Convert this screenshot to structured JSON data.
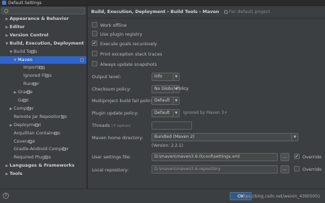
{
  "window": {
    "title": "Default Settings"
  },
  "sidebar": {
    "items": [
      {
        "label": "Appearance & Behavior",
        "arrow": "▶",
        "level": 0,
        "bold": true
      },
      {
        "label": "Editor",
        "arrow": "▶",
        "level": 0,
        "bold": true
      },
      {
        "label": "Version Control",
        "arrow": "▶",
        "level": 0,
        "bold": true
      },
      {
        "label": "Build, Execution, Deployment",
        "arrow": "▼",
        "level": 0,
        "bold": true
      },
      {
        "label": "Build Tools",
        "arrow": "▼",
        "level": 1
      },
      {
        "label": "Maven",
        "arrow": "▼",
        "level": 2,
        "active": true
      },
      {
        "label": "Importing",
        "arrow": "",
        "level": 3
      },
      {
        "label": "Ignored Files",
        "arrow": "",
        "level": 3
      },
      {
        "label": "Runner",
        "arrow": "",
        "level": 3
      },
      {
        "label": "Gradle",
        "arrow": "▶",
        "level": 2
      },
      {
        "label": "Gant",
        "arrow": "",
        "level": 2
      },
      {
        "label": "Compiler",
        "arrow": "▶",
        "level": 1
      },
      {
        "label": "Remote Jar Repositories",
        "arrow": "",
        "level": 1
      },
      {
        "label": "Deployment",
        "arrow": "▶",
        "level": 1
      },
      {
        "label": "Arquillian Containers",
        "arrow": "",
        "level": 1
      },
      {
        "label": "Coverage",
        "arrow": "",
        "level": 1
      },
      {
        "label": "Gradle-Android Compiler",
        "arrow": "",
        "level": 1
      },
      {
        "label": "Required Plugins",
        "arrow": "",
        "level": 1
      },
      {
        "label": "Languages & Frameworks",
        "arrow": "▶",
        "level": 0,
        "bold": true
      },
      {
        "label": "Tools",
        "arrow": "▶",
        "level": 0,
        "bold": true
      }
    ]
  },
  "breadcrumb": {
    "path": "Build, Execution, Deployment › Build Tools › Maven",
    "scope": "For default project"
  },
  "checkboxes": [
    {
      "label": "Work offline",
      "checked": false
    },
    {
      "label": "Use plugin registry",
      "checked": false
    },
    {
      "label": "Execute goals recursively",
      "checked": true
    },
    {
      "label": "Print exception stack traces",
      "checked": false
    },
    {
      "label": "Always update snapshots",
      "checked": false
    }
  ],
  "fields": {
    "output_level": {
      "label": "Output level:",
      "value": "Info"
    },
    "checksum_policy": {
      "label": "Checksum policy:",
      "value": "No Global Policy"
    },
    "build_fail_policy": {
      "label": "Multiproject build fail policy:",
      "value": "Default"
    },
    "plugin_update_policy": {
      "label": "Plugin update policy:",
      "value": "Default",
      "note": "ignored by Maven 3+"
    },
    "threads": {
      "label": "Threads",
      "hint": "(-T option)",
      "value": ""
    },
    "maven_home": {
      "label": "Maven home directory:",
      "value": "Bundled (Maven 2)",
      "version": "(Version: 2.2.1)"
    },
    "user_settings": {
      "label": "User settings file:",
      "value": "D:\\maven\\maven3.6.0\\conf\\settings.xml",
      "override_label": "Override",
      "override": true
    },
    "local_repo": {
      "label": "Local repository:",
      "value": "D:\\maven\\maven3.6-repository",
      "override_label": "Override",
      "override": false
    }
  },
  "buttons": {
    "browse": "...",
    "ok": "OK",
    "help": "?"
  },
  "watermark": "https://blog.csdn.net/weixin_43905001"
}
